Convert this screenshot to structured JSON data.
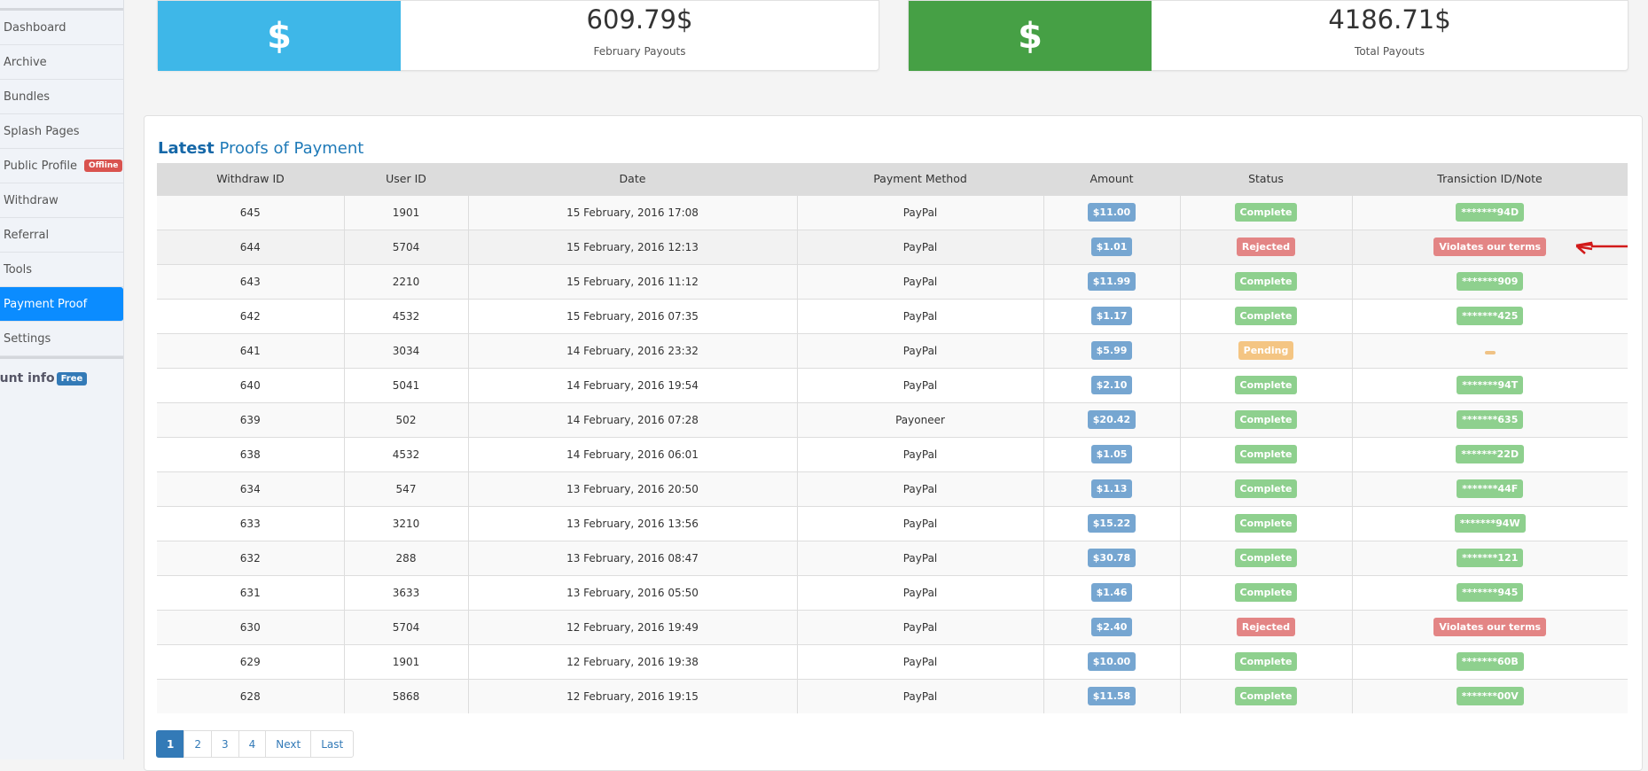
{
  "sidebar": {
    "items": [
      {
        "label": "Dashboard"
      },
      {
        "label": "Archive"
      },
      {
        "label": "Bundles"
      },
      {
        "label": "Splash Pages"
      },
      {
        "label": "Public Profile",
        "badge": "Offline"
      },
      {
        "label": "Withdraw"
      },
      {
        "label": "Referral"
      },
      {
        "label": "Tools"
      },
      {
        "label": "Payment Proof",
        "active": true
      },
      {
        "label": "Settings"
      }
    ],
    "account_info": "ount info",
    "account_badge": "Free"
  },
  "cards": [
    {
      "icon": "$",
      "value": "609.79$",
      "label": "February Payouts",
      "color": "#3eb7e8"
    },
    {
      "icon": "$",
      "value": "4186.71$",
      "label": "Total Payouts",
      "color": "#46a045"
    }
  ],
  "panel": {
    "title_bold": "Latest",
    "title_rest": " Proofs of Payment"
  },
  "table": {
    "headers": [
      "Withdraw ID",
      "User ID",
      "Date",
      "Payment Method",
      "Amount",
      "Status",
      "Transiction ID/Note"
    ],
    "rows": [
      [
        "645",
        "1901",
        "15 February, 2016 17:08",
        "PayPal",
        "$11.00",
        "Complete",
        "*******94D"
      ],
      [
        "644",
        "5704",
        "15 February, 2016 12:13",
        "PayPal",
        "$1.01",
        "Rejected",
        "Violates our terms"
      ],
      [
        "643",
        "2210",
        "15 February, 2016 11:12",
        "PayPal",
        "$11.99",
        "Complete",
        "*******909"
      ],
      [
        "642",
        "4532",
        "15 February, 2016 07:35",
        "PayPal",
        "$1.17",
        "Complete",
        "*******425"
      ],
      [
        "641",
        "3034",
        "14 February, 2016 23:32",
        "PayPal",
        "$5.99",
        "Pending",
        ""
      ],
      [
        "640",
        "5041",
        "14 February, 2016 19:54",
        "PayPal",
        "$2.10",
        "Complete",
        "*******94T"
      ],
      [
        "639",
        "502",
        "14 February, 2016 07:28",
        "Payoneer",
        "$20.42",
        "Complete",
        "*******635"
      ],
      [
        "638",
        "4532",
        "14 February, 2016 06:01",
        "PayPal",
        "$1.05",
        "Complete",
        "*******22D"
      ],
      [
        "634",
        "547",
        "13 February, 2016 20:50",
        "PayPal",
        "$1.13",
        "Complete",
        "*******44F"
      ],
      [
        "633",
        "3210",
        "13 February, 2016 13:56",
        "PayPal",
        "$15.22",
        "Complete",
        "*******94W"
      ],
      [
        "632",
        "288",
        "13 February, 2016 08:47",
        "PayPal",
        "$30.78",
        "Complete",
        "*******121"
      ],
      [
        "631",
        "3633",
        "13 February, 2016 05:50",
        "PayPal",
        "$1.46",
        "Complete",
        "*******945"
      ],
      [
        "630",
        "5704",
        "12 February, 2016 19:49",
        "PayPal",
        "$2.40",
        "Rejected",
        "Violates our terms"
      ],
      [
        "629",
        "1901",
        "12 February, 2016 19:38",
        "PayPal",
        "$10.00",
        "Complete",
        "*******60B"
      ],
      [
        "628",
        "5868",
        "12 February, 2016 19:15",
        "PayPal",
        "$11.58",
        "Complete",
        "*******00V"
      ]
    ]
  },
  "pagination": [
    "1",
    "2",
    "3",
    "4",
    "Next",
    "Last"
  ],
  "colors": {
    "accent": "#0b8cff",
    "complete": "#8ed08e",
    "rejected": "#e38585",
    "pending": "#f4c583",
    "amount": "#76a6d1"
  }
}
